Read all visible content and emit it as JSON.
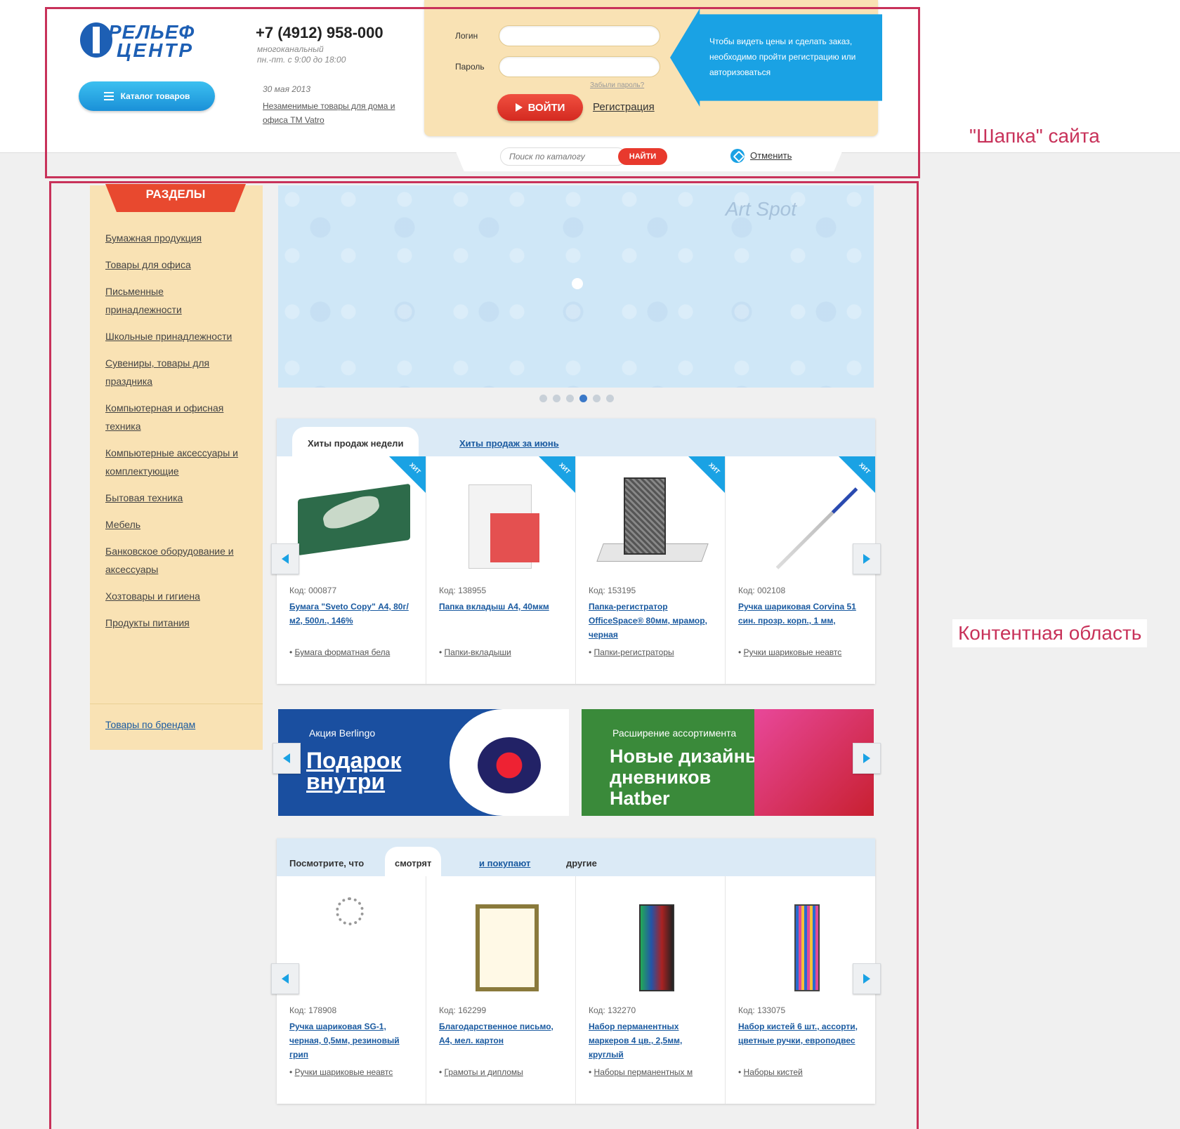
{
  "header": {
    "logo_line1": "РЕЛЬЕФ",
    "logo_line2": "ЦЕНТР",
    "catalog_button": "Каталог товаров",
    "phone": "+7 (4912) 958-000",
    "phone_type": "многоканальный",
    "hours": "пн.-пт. с 9:00 до 18:00",
    "news_date": "30 мая 2013",
    "news_text": "Незаменимые товары для дома и офиса ТМ Vatro",
    "login_label": "Логин",
    "password_label": "Пароль",
    "forgot_password": "Забыли пароль?",
    "login_button": "ВОЙТИ",
    "register_link": "Регистрация",
    "info_text": "Чтобы видеть цены и сделать заказ, необходимо пройти регистрацию или авторизоваться",
    "search_placeholder": "Поиск по каталогу",
    "search_button": "НАЙТИ",
    "notes_link": "Отменить"
  },
  "annotations": {
    "header_label": "\"Шапка\" сайта",
    "content_label": "Контентная область"
  },
  "sidebar": {
    "title": "РАЗДЕЛЫ",
    "items": [
      "Бумажная продукция",
      "Товары для офиса",
      "Письменные принадлежности",
      "Школьные принадлежности",
      "Сувениры, товары для праздника",
      "Компьютерная и офисная техника",
      "Компьютерные аксессуары и комплектующие",
      "Бытовая техника",
      "Мебель",
      "Банковское оборудование и аксессуары",
      "Хозтовары и гигиена",
      "Продукты питания"
    ],
    "brands_link": "Товары по брендам"
  },
  "banner": {
    "watermark": "Art Spot",
    "dot_count": 6,
    "active_dot": 3
  },
  "hits": {
    "tab_active": "Хиты продаж недели",
    "tab_other": "Хиты продаж за июнь",
    "badge": "ХИТ",
    "products": [
      {
        "code": "Код: 000877",
        "name": "Бумага \"Sveto Copy\" А4, 80г/м2, 500л., 146%",
        "category": "Бумага форматная бела"
      },
      {
        "code": "Код: 138955",
        "name": "Папка вкладыш А4, 40мкм",
        "category": "Папки-вкладыши"
      },
      {
        "code": "Код: 153195",
        "name": "Папка-регистратор OfficeSpace® 80мм, мрамор, черная",
        "category": "Папки-регистраторы"
      },
      {
        "code": "Код: 002108",
        "name": "Ручка шариковая Corvina 51 син. прозр. корп., 1 мм,",
        "category": "Ручки шариковые неавтс"
      }
    ]
  },
  "promos": [
    {
      "small": "Акция Berlingo",
      "big_line1": "Подарок",
      "big_line2": "внутри"
    },
    {
      "small": "Расширение ассортимента",
      "big_line1": "Новые дизайны",
      "big_line2": "дневников",
      "big_line3": "Hatber"
    }
  ],
  "watched": {
    "tab_prefix": "Посмотрите, что",
    "tab_active": "смотрят",
    "tab_link": "и покупают",
    "tab_suffix": "другие",
    "products": [
      {
        "code": "Код: 178908",
        "name": "Ручка шариковая SG-1, черная, 0,5мм, резиновый грип",
        "category": "Ручки шариковые неавтс"
      },
      {
        "code": "Код: 162299",
        "name": "Благодарственное письмо, А4, мел. картон",
        "category": "Грамоты и дипломы"
      },
      {
        "code": "Код: 132270",
        "name": "Набор перманентных маркеров 4 цв., 2,5мм, круглый",
        "category": "Наборы перманентных м"
      },
      {
        "code": "Код: 133075",
        "name": "Набор кистей 6 шт., ассорти, цветные ручки, европодвес",
        "category": "Наборы кистей"
      }
    ]
  }
}
